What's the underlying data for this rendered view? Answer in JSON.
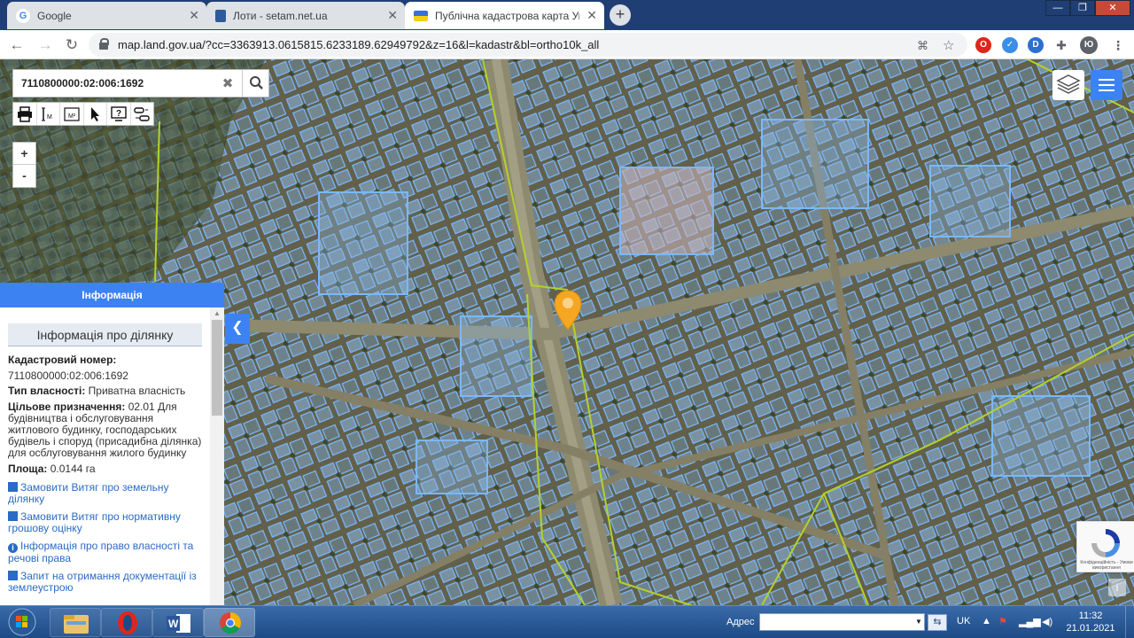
{
  "browser": {
    "tabs": [
      {
        "title": "Google",
        "favicon": "google-icon"
      },
      {
        "title": "Лоти - setam.net.ua",
        "favicon": "setam-icon"
      },
      {
        "title": "Публічна кадастрова карта Укр",
        "favicon": "ukraine-flag-icon"
      }
    ],
    "new_tab": "+",
    "window_controls": {
      "minimize": "—",
      "restore": "❐",
      "close": "✕"
    },
    "url": "map.land.gov.ua/?cc=3363913.0615815.6233189.62949792&z=16&l=kadastr&bl=ortho10k_all",
    "extensions": [
      "opera-icon",
      "extension-blue-icon",
      "extension-d-icon",
      "puzzle-icon"
    ],
    "profile_initial": "Ю"
  },
  "map": {
    "search": {
      "value": "7110800000:02:006:1692",
      "clear": "✖"
    },
    "zoom": {
      "in": "+",
      "out": "-"
    },
    "tools": [
      "print-icon",
      "measure-line-icon",
      "measure-area-icon",
      "pointer-icon",
      "identify-icon",
      "route-icon"
    ],
    "collapse": "❮",
    "info_button": "i"
  },
  "info_panel": {
    "header": "Інформація",
    "section_title": "Інформація про ділянку",
    "cadastral_label": "Кадастровий номер:",
    "cadastral_value": "7110800000:02:006:1692",
    "ownership_label": "Тип власності:",
    "ownership_value": "Приватна власність",
    "purpose_label": "Цільове призначення:",
    "purpose_value": "02.01 Для будівництва і обслуговування житлового будинку, господарських будівель і споруд (присадибна ділянка) для осблуговування жилого будинку",
    "area_label": "Площа:",
    "area_value": "0.0144 га",
    "links": [
      "Замовити Витяг про земельну ділянку",
      "Замовити Витяг про нормативну грошову оцінку",
      "Інформація про право власності та речові права",
      "Запит на отримання документації із землеустрою"
    ]
  },
  "recaptcha": {
    "text": "Конфіденційність - Умови використання"
  },
  "taskbar": {
    "address_label": "Адрес",
    "address_value": "",
    "language": "UK",
    "time": "11:32",
    "date": "21.01.2021"
  },
  "colors": {
    "accent": "#3d82f3",
    "parcel": "#7ab8ff",
    "boundary": "#b5d12a",
    "tabbar": "#1f3f74"
  }
}
